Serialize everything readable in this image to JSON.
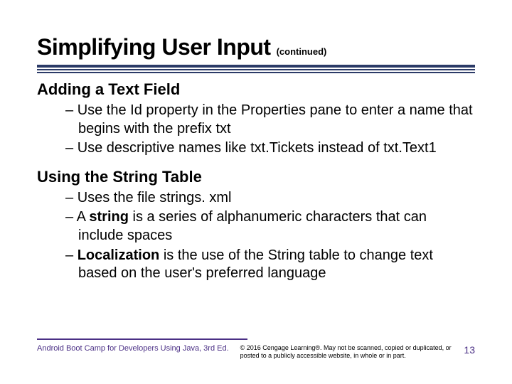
{
  "title": "Simplifying User Input",
  "continued": "(continued)",
  "sections": [
    {
      "heading": "Adding a Text Field",
      "bullets": [
        {
          "text": "Use the Id property in the Properties pane to enter a name that begins with the prefix txt"
        },
        {
          "text": "Use descriptive names like txt.Tickets instead of txt.Text1"
        }
      ]
    },
    {
      "heading": "Using the String Table",
      "bullets": [
        {
          "text": "Uses the file strings. xml"
        },
        {
          "pre": "A ",
          "bold": "string",
          "post": " is a series of alphanumeric characters that can include spaces"
        },
        {
          "bold": "Localization",
          "post": " is the use of the String table to change text based on the user's preferred language"
        }
      ]
    }
  ],
  "footer": {
    "left": "Android Boot Camp for Developers Using Java, 3rd Ed.",
    "mid": "© 2016 Cengage Learning®. May not be scanned, copied or duplicated, or posted to a publicly accessible website, in whole or in part.",
    "page": "13"
  }
}
